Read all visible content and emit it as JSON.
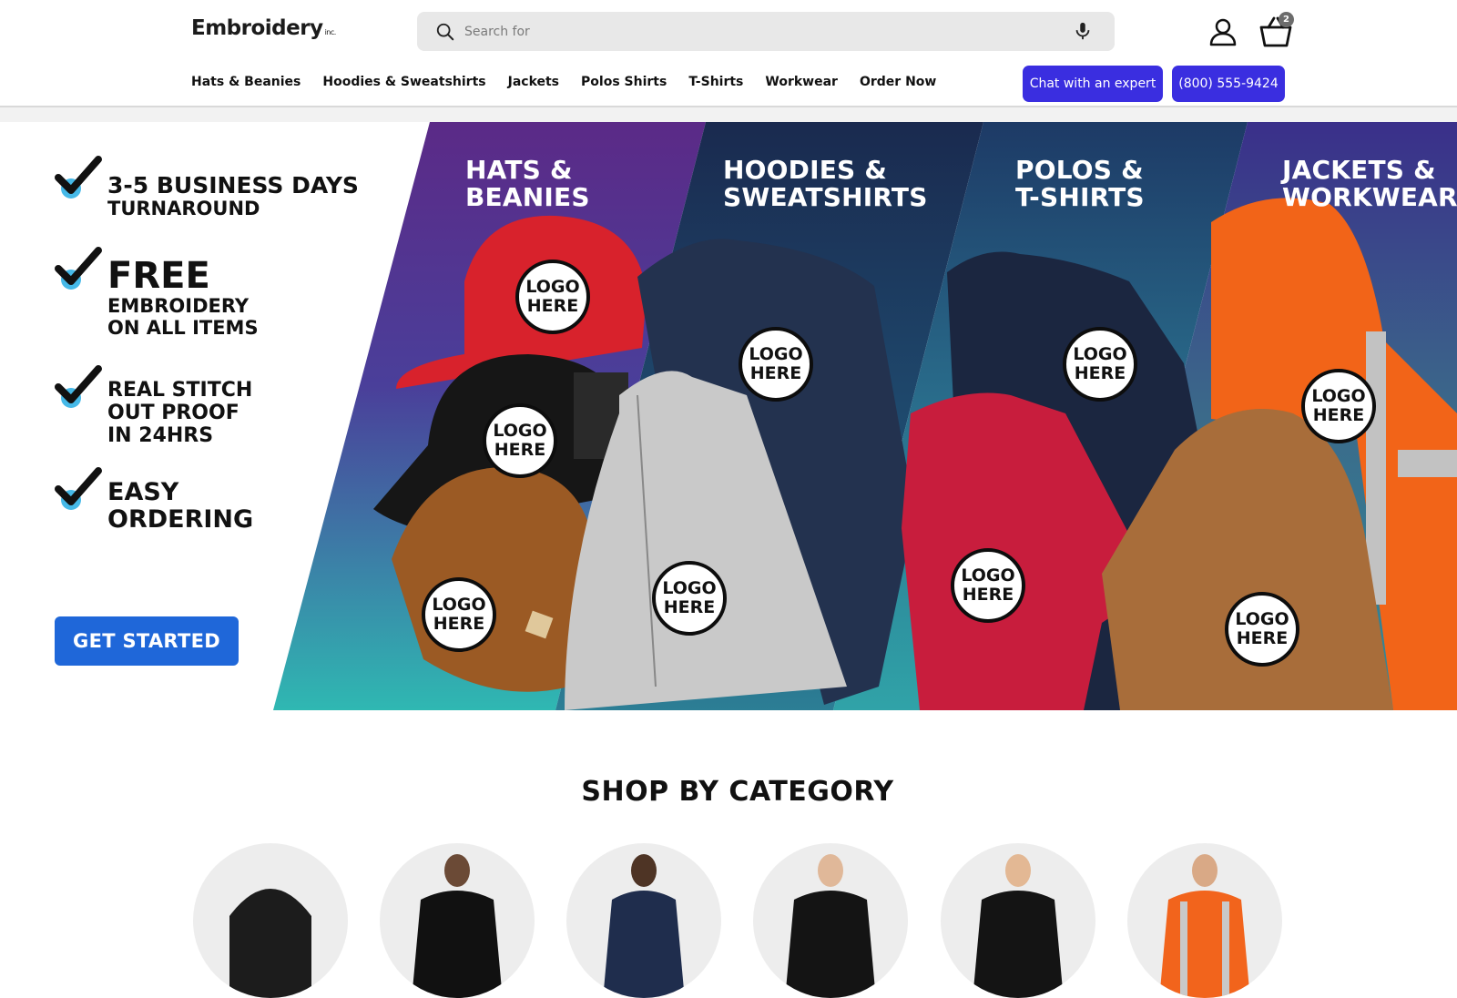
{
  "header": {
    "logo_text": "Embroidery",
    "logo_suffix": "inc.",
    "search_placeholder": "Search for",
    "cart_count": "2"
  },
  "nav": {
    "items": [
      "Hats & Beanies",
      "Hoodies & Sweatshirts",
      "Jackets",
      "Polos Shirts",
      "T-Shirts",
      "Workwear",
      "Order Now"
    ]
  },
  "actions": {
    "chat_label": "Chat with an expert",
    "phone_label": "(800) 555-9424"
  },
  "hero": {
    "panels": [
      {
        "line1": "HATS &",
        "line2": "BEANIES"
      },
      {
        "line1": "HOODIES &",
        "line2": "SWEATSHIRTS"
      },
      {
        "line1": "POLOS &",
        "line2": "T-SHIRTS"
      },
      {
        "line1": "JACKETS &",
        "line2": "WORKWEAR"
      }
    ],
    "benefits": [
      {
        "line1": "3-5 BUSINESS DAYS",
        "line2": "TURNAROUND"
      },
      {
        "line1": "FREE",
        "line2": "EMBROIDERY",
        "line3": "ON ALL ITEMS"
      },
      {
        "line1": "REAL STITCH",
        "line2": "OUT PROOF",
        "line3": "IN 24HRS"
      },
      {
        "line1": "EASY",
        "line2": "ORDERING"
      }
    ],
    "logo_placeholder_line1": "LOGO",
    "logo_placeholder_line2": "HERE",
    "cta_label": "GET STARTED",
    "colors": {
      "panel_hats": "#5a2d86",
      "panel_hoodies": "#1e3a5f",
      "panel_polos": "#2a6d8a",
      "panel_jackets": "#3b5a78",
      "teal": "#2fb5b0",
      "cta": "#1f67d9"
    }
  },
  "category_section": {
    "title": "SHOP BY CATEGORY",
    "items": [
      "beanie",
      "hoodie-man",
      "jacket-woman",
      "polo-man",
      "tshirt-man",
      "hi-vis-man"
    ]
  }
}
